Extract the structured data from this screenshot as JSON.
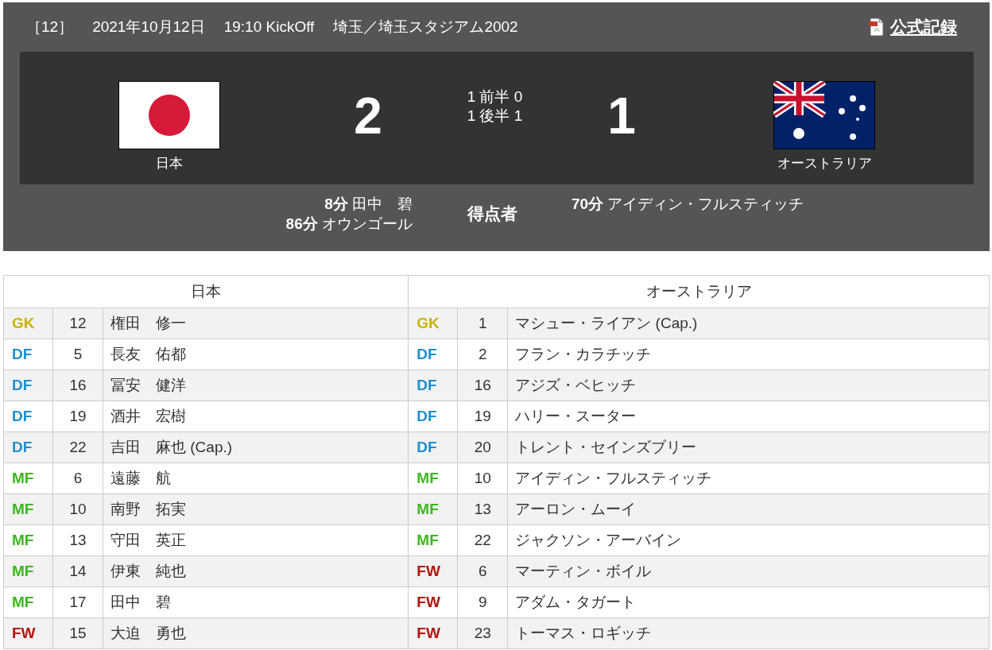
{
  "match": {
    "number": "［12］",
    "date": "2021年10月12日",
    "kickoff": "19:10 KickOff",
    "venue": "埼玉／埼玉スタジアム2002",
    "record_link": "公式記録"
  },
  "score": {
    "home": {
      "name": "日本",
      "goals": "2"
    },
    "away": {
      "name": "オーストラリア",
      "goals": "1"
    },
    "halves": [
      {
        "home": "1",
        "label": "前半",
        "away": "0"
      },
      {
        "home": "1",
        "label": "後半",
        "away": "1"
      }
    ]
  },
  "scorers": {
    "label": "得点者",
    "home": [
      {
        "minute": "8分",
        "name": "田中　碧"
      },
      {
        "minute": "86分",
        "name": "オウンゴール"
      }
    ],
    "away": [
      {
        "minute": "70分",
        "name": "アイディン・フルスティッチ"
      }
    ]
  },
  "lineups": [
    {
      "team": "日本",
      "players": [
        {
          "position": "GK",
          "color": "#c8b400",
          "number": "12",
          "name": "権田　修一"
        },
        {
          "position": "DF",
          "color": "#1e8fd0",
          "number": "5",
          "name": "長友　佑都"
        },
        {
          "position": "DF",
          "color": "#1e8fd0",
          "number": "16",
          "name": "冨安　健洋"
        },
        {
          "position": "DF",
          "color": "#1e8fd0",
          "number": "19",
          "name": "酒井　宏樹"
        },
        {
          "position": "DF",
          "color": "#1e8fd0",
          "number": "22",
          "name": "吉田　麻也 (Cap.)"
        },
        {
          "position": "MF",
          "color": "#3cb81e",
          "number": "6",
          "name": "遠藤　航"
        },
        {
          "position": "MF",
          "color": "#3cb81e",
          "number": "10",
          "name": "南野　拓実"
        },
        {
          "position": "MF",
          "color": "#3cb81e",
          "number": "13",
          "name": "守田　英正"
        },
        {
          "position": "MF",
          "color": "#3cb81e",
          "number": "14",
          "name": "伊東　純也"
        },
        {
          "position": "MF",
          "color": "#3cb81e",
          "number": "17",
          "name": "田中　碧"
        },
        {
          "position": "FW",
          "color": "#b4140a",
          "number": "15",
          "name": "大迫　勇也"
        }
      ]
    },
    {
      "team": "オーストラリア",
      "players": [
        {
          "position": "GK",
          "color": "#c8b400",
          "number": "1",
          "name": "マシュー・ライアン (Cap.)"
        },
        {
          "position": "DF",
          "color": "#1e8fd0",
          "number": "2",
          "name": "フラン・カラチッチ"
        },
        {
          "position": "DF",
          "color": "#1e8fd0",
          "number": "16",
          "name": "アジズ・ベヒッチ"
        },
        {
          "position": "DF",
          "color": "#1e8fd0",
          "number": "19",
          "name": "ハリー・スーター"
        },
        {
          "position": "DF",
          "color": "#1e8fd0",
          "number": "20",
          "name": "トレント・セインズブリー"
        },
        {
          "position": "MF",
          "color": "#3cb81e",
          "number": "10",
          "name": "アイディン・フルスティッチ"
        },
        {
          "position": "MF",
          "color": "#3cb81e",
          "number": "13",
          "name": "アーロン・ムーイ"
        },
        {
          "position": "MF",
          "color": "#3cb81e",
          "number": "22",
          "name": "ジャクソン・アーバイン"
        },
        {
          "position": "FW",
          "color": "#b4140a",
          "number": "6",
          "name": "マーティン・ボイル"
        },
        {
          "position": "FW",
          "color": "#b4140a",
          "number": "9",
          "name": "アダム・タガート"
        },
        {
          "position": "FW",
          "color": "#b4140a",
          "number": "23",
          "name": "トーマス・ロギッチ"
        }
      ]
    }
  ]
}
